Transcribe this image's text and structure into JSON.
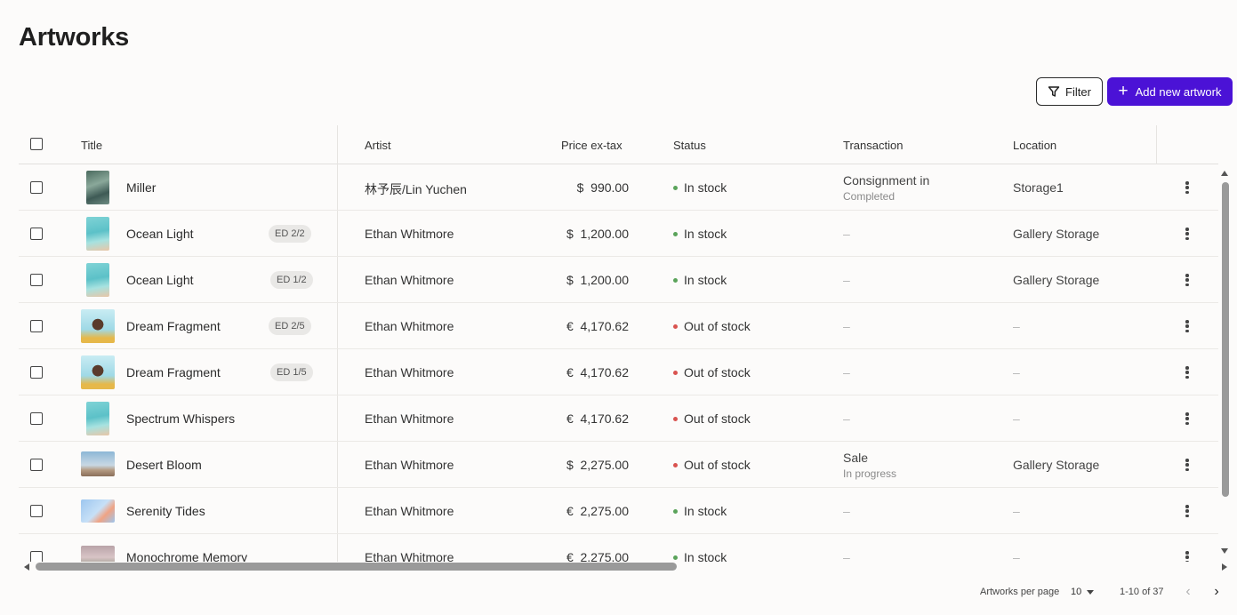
{
  "page": {
    "title": "Artworks"
  },
  "toolbar": {
    "filter_label": "Filter",
    "add_label": "Add new artwork"
  },
  "columns": {
    "title": "Title",
    "artist": "Artist",
    "price": "Price ex-tax",
    "status": "Status",
    "transaction": "Transaction",
    "location": "Location"
  },
  "colors": {
    "accent": "#4b12d6",
    "in_stock": "#5aa35a",
    "out_of_stock": "#d9534f"
  },
  "rows": [
    {
      "title": "Miller",
      "edition": "",
      "artist": "林予辰/Lin Yuchen",
      "price": "$  990.00",
      "status": "In stock",
      "status_kind": "in",
      "transaction": "Consignment in",
      "transaction_sub": "Completed",
      "location": "Storage1"
    },
    {
      "title": "Ocean Light",
      "edition": "ED 2/2",
      "artist": "Ethan Whitmore",
      "price": "$  1,200.00",
      "status": "In stock",
      "status_kind": "in",
      "transaction": "–",
      "transaction_sub": "",
      "location": "Gallery Storage"
    },
    {
      "title": "Ocean Light",
      "edition": "ED 1/2",
      "artist": "Ethan Whitmore",
      "price": "$  1,200.00",
      "status": "In stock",
      "status_kind": "in",
      "transaction": "–",
      "transaction_sub": "",
      "location": "Gallery Storage"
    },
    {
      "title": "Dream Fragment",
      "edition": "ED 2/5",
      "artist": "Ethan Whitmore",
      "price": "€  4,170.62",
      "status": "Out of stock",
      "status_kind": "out",
      "transaction": "–",
      "transaction_sub": "",
      "location": "–"
    },
    {
      "title": "Dream Fragment",
      "edition": "ED 1/5",
      "artist": "Ethan Whitmore",
      "price": "€  4,170.62",
      "status": "Out of stock",
      "status_kind": "out",
      "transaction": "–",
      "transaction_sub": "",
      "location": "–"
    },
    {
      "title": "Spectrum Whispers",
      "edition": "",
      "artist": "Ethan Whitmore",
      "price": "€  4,170.62",
      "status": "Out of stock",
      "status_kind": "out",
      "transaction": "–",
      "transaction_sub": "",
      "location": "–"
    },
    {
      "title": "Desert Bloom",
      "edition": "",
      "artist": "Ethan Whitmore",
      "price": "$  2,275.00",
      "status": "Out of stock",
      "status_kind": "out",
      "transaction": "Sale",
      "transaction_sub": "In progress",
      "location": "Gallery Storage"
    },
    {
      "title": "Serenity Tides",
      "edition": "",
      "artist": "Ethan Whitmore",
      "price": "€  2,275.00",
      "status": "In stock",
      "status_kind": "in",
      "transaction": "–",
      "transaction_sub": "",
      "location": "–"
    },
    {
      "title": "Monochrome Memory",
      "edition": "",
      "artist": "Ethan Whitmore",
      "price": "€  2,275.00",
      "status": "In stock",
      "status_kind": "in",
      "transaction": "–",
      "transaction_sub": "",
      "location": "–"
    }
  ],
  "pagination": {
    "per_page_label": "Artworks per page",
    "per_page_value": "10",
    "range": "1-10 of 37"
  }
}
